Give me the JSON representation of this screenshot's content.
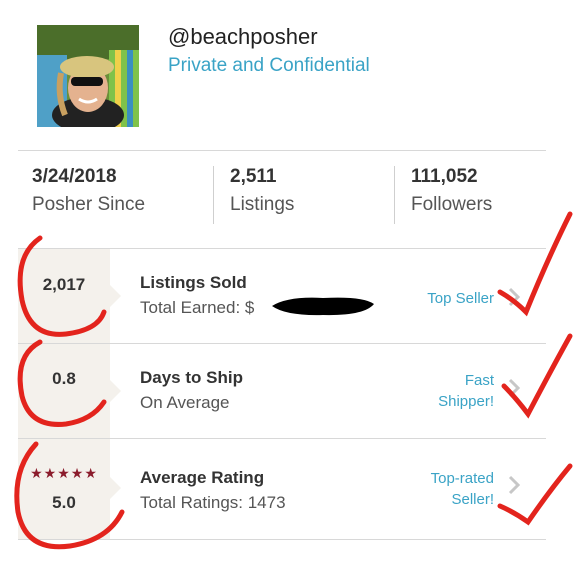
{
  "profile": {
    "username": "@beachposher",
    "tagline": "Private and Confidential"
  },
  "stats": [
    {
      "value": "3/24/2018",
      "label": "Posher Since"
    },
    {
      "value": "2,511",
      "label": "Listings"
    },
    {
      "value": "111,052",
      "label": "Followers"
    }
  ],
  "rows": [
    {
      "value": "2,017",
      "title": "Listings Sold",
      "sub": "Total Earned: $",
      "badge": "Top Seller"
    },
    {
      "value": "0.8",
      "title": "Days to Ship",
      "sub": "On Average",
      "badge_line1": "Fast",
      "badge_line2": "Shipper!"
    },
    {
      "stars": "★★★★★",
      "value": "5.0",
      "title": "Average Rating",
      "sub": "Total Ratings: 1473",
      "badge_line1": "Top-rated",
      "badge_line2": "Seller!"
    }
  ],
  "colors": {
    "accent": "#3aa3c6",
    "star": "#8b1c2c",
    "annotation": "#e3241d"
  },
  "icons": {
    "chevron": "chevron-right-icon",
    "star": "star-icon"
  }
}
